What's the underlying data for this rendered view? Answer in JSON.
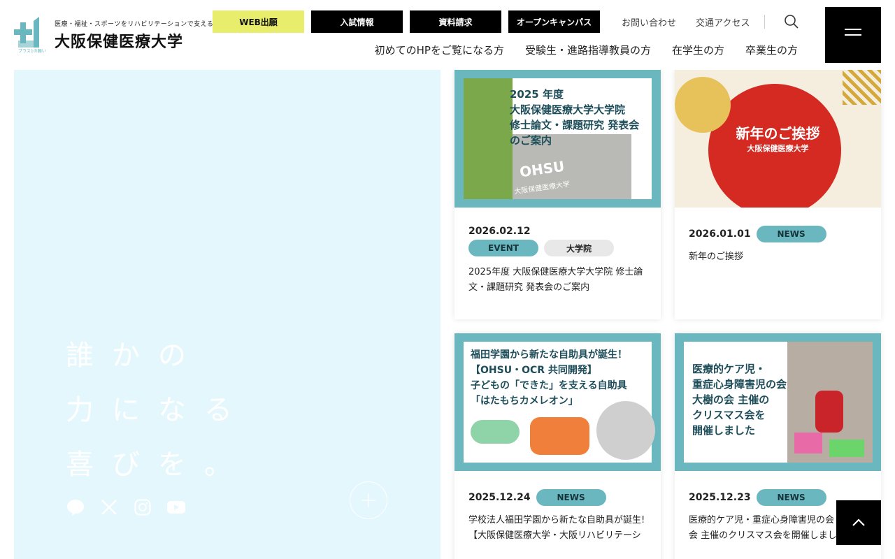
{
  "brand": {
    "tagline": "医療・福祉・スポーツをリハビリテーションで支える",
    "name": "大阪保健医療大学",
    "mark_caption": "プラス1の願い",
    "accent": "#6ab7bf",
    "web_accent": "#e8ee6c"
  },
  "top_buttons": [
    {
      "label": "WEB出願"
    },
    {
      "label": "入試情報"
    },
    {
      "label": "資料請求"
    },
    {
      "label": "オープンキャンパス"
    }
  ],
  "util_links": [
    {
      "label": "お問い合わせ"
    },
    {
      "label": "交通アクセス"
    }
  ],
  "main_nav": [
    {
      "label": "初めてのHPをご覧になる方"
    },
    {
      "label": "受験生・進路指導教員の方"
    },
    {
      "label": "在学生の方"
    },
    {
      "label": "卒業生の方"
    }
  ],
  "hero": {
    "lines": [
      "誰かの",
      "力になる",
      "喜びを。"
    ],
    "social": [
      "line-icon",
      "x-icon",
      "instagram-icon",
      "youtube-icon"
    ]
  },
  "cards": [
    {
      "date": "2026.02.12",
      "tags": [
        "EVENT",
        "大学院"
      ],
      "title": "2025年度 大阪保健医療大学大学院 修士論文・課題研究 発表会のご案内",
      "thumb": {
        "lines": [
          "2025 年度",
          "大阪保健医療大学大学院",
          "修士論文・課題研究 発表会",
          "のご案内"
        ],
        "sign": "OHSU",
        "sign_sub": "大阪保健医療大学"
      }
    },
    {
      "date": "2026.01.01",
      "tags": [
        "NEWS"
      ],
      "title": "新年のご挨拶",
      "thumb": {
        "lines": [
          "新年のご挨拶",
          "大阪保健医療大学"
        ]
      }
    },
    {
      "date": "2025.12.24",
      "tags": [
        "NEWS"
      ],
      "title": "学校法人福田学園から新たな自助具が誕生!【大阪保健医療大学・大阪リハビリテーション専門学校共同開発】",
      "thumb": {
        "lines": [
          "福田学園から新たな自助具が誕生！",
          "【OHSU・OCR 共同開発】",
          "子どもの「できた」を支える自助具",
          "「はたもちカメレオン」"
        ]
      }
    },
    {
      "date": "2025.12.23",
      "tags": [
        "NEWS"
      ],
      "title": "医療的ケア児・重症心身障害児の会 大樹の会 主催のクリスマス会を開催しました",
      "thumb": {
        "lines": [
          "医療的ケア児・",
          "重症心身障害児の会",
          "大樹の会 主催の",
          "クリスマス会を",
          "開催しました"
        ]
      }
    }
  ]
}
